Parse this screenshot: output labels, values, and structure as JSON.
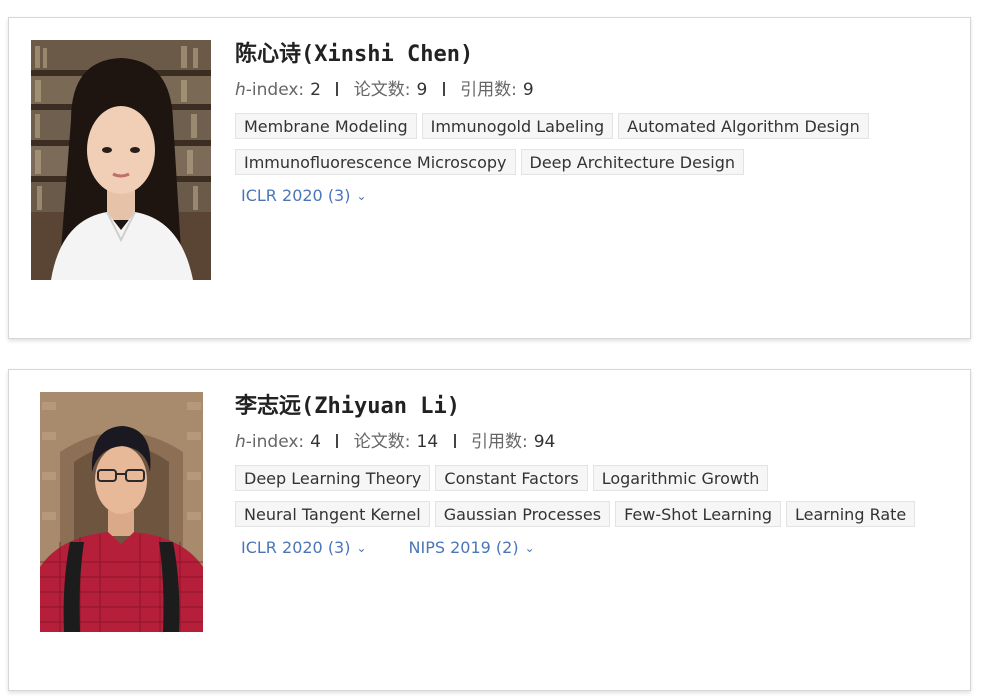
{
  "authors": [
    {
      "name": "陈心诗(Xinshi Chen)",
      "hindex_label_italic": "h",
      "hindex_label_rest": "-index:",
      "hindex": "2",
      "papers_label": "论文数:",
      "papers": "9",
      "citations_label": "引用数:",
      "citations": "9",
      "tags": [
        "Membrane Modeling",
        "Immunogold Labeling",
        "Automated Algorithm Design",
        "Immunofluorescence Microscopy",
        "Deep Architecture Design"
      ],
      "venues": [
        "ICLR 2020 (3)"
      ]
    },
    {
      "name": "李志远(Zhiyuan Li)",
      "hindex_label_italic": "h",
      "hindex_label_rest": "-index:",
      "hindex": "4",
      "papers_label": "论文数:",
      "papers": "14",
      "citations_label": "引用数:",
      "citations": "94",
      "tags": [
        "Deep Learning Theory",
        "Constant Factors",
        "Logarithmic Growth",
        "Neural Tangent Kernel",
        "Gaussian Processes",
        "Few-Shot Learning",
        "Learning Rate"
      ],
      "venues": [
        "ICLR 2020 (3)",
        "NIPS 2019 (2)"
      ]
    }
  ],
  "icons": {
    "venue_expand": "chevron-down-icon"
  },
  "colors": {
    "link": "#4a76b8",
    "tag_bg": "#f6f6f6",
    "tag_border": "#e3e3e3",
    "card_border": "#d6d6d6"
  }
}
